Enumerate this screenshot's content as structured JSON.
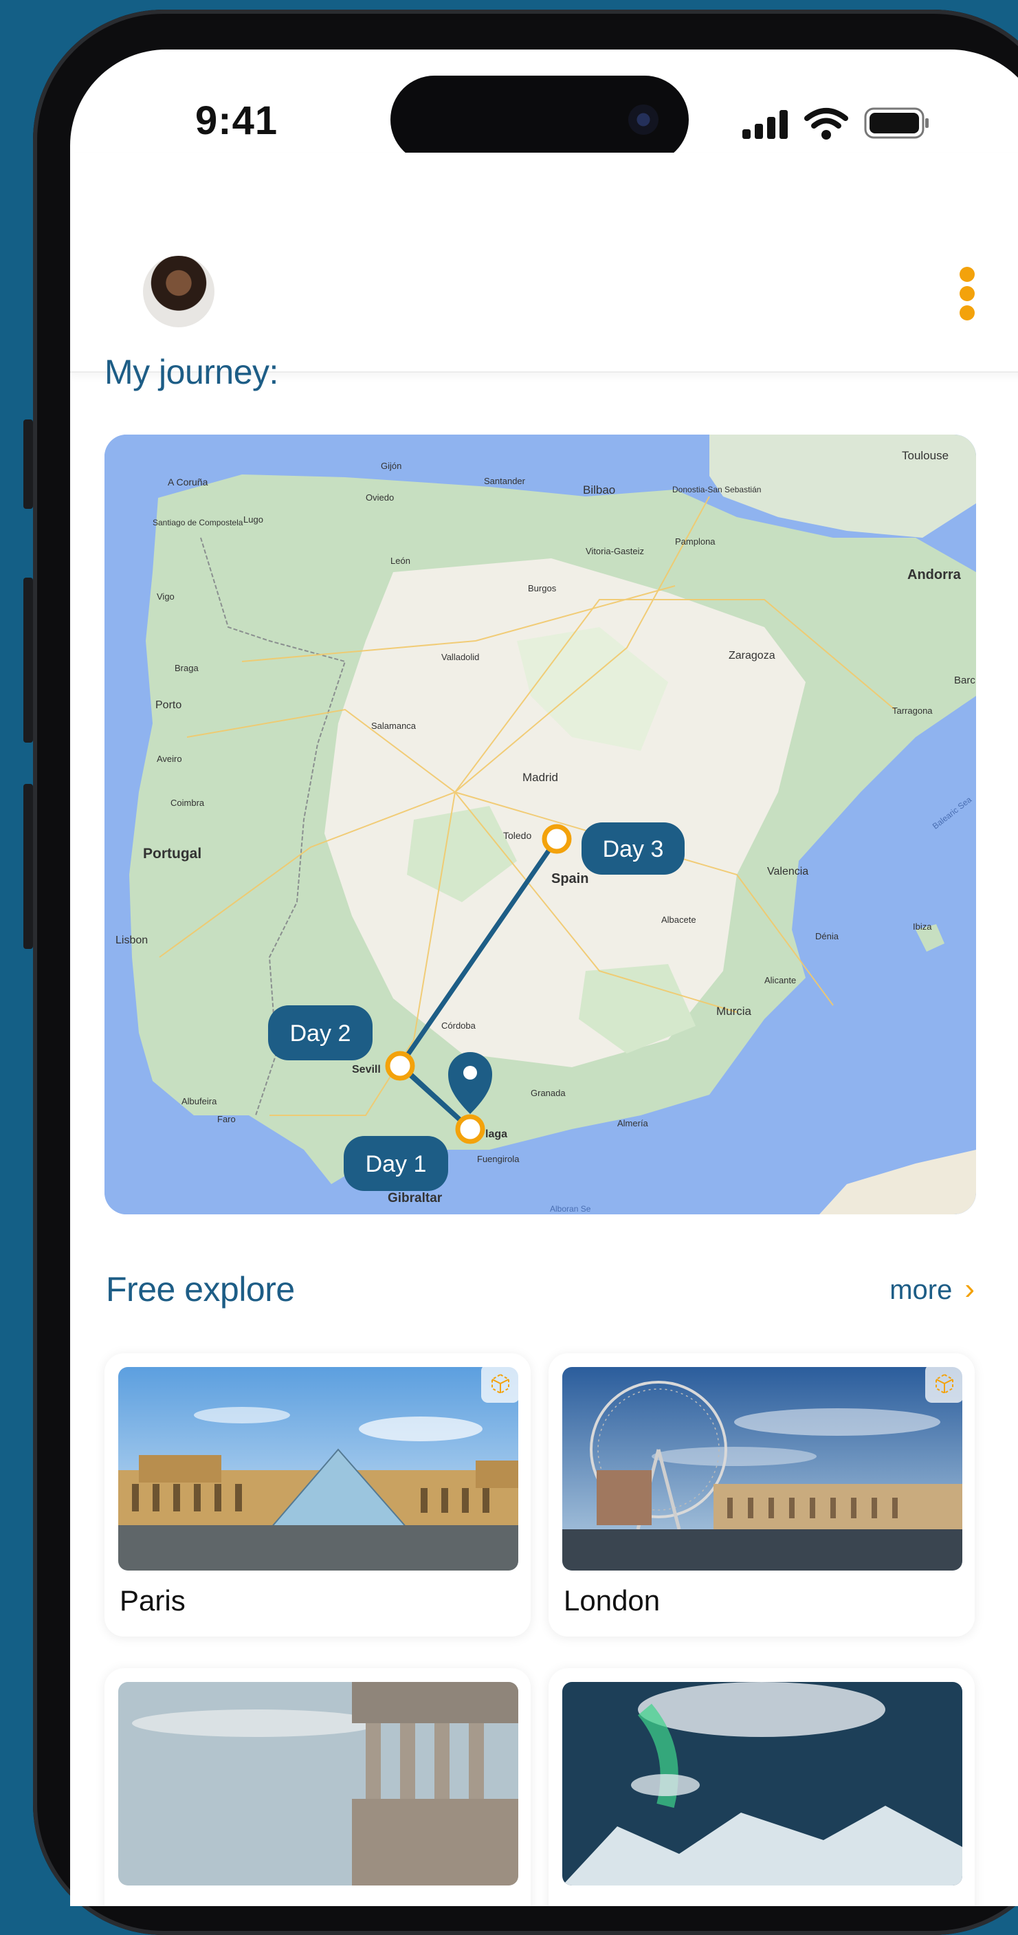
{
  "status_bar": {
    "time": "9:41"
  },
  "colors": {
    "accent_orange": "#f3a20b",
    "primary_blue": "#1d5d86",
    "background": "#145f86"
  },
  "header": {
    "avatar": "avatar",
    "menu_icon": "more-vertical-icon"
  },
  "journey": {
    "title": "My journey:",
    "map": {
      "place_labels": [
        "Toulouse",
        "A Coruña",
        "Gijón",
        "Santander",
        "Bilbao",
        "Donostia-San Sebastián",
        "Oviedo",
        "Lugo",
        "Santiago de Compostela",
        "Vitoria-Gasteiz",
        "Pamplona",
        "León",
        "Andorra",
        "Burgos",
        "Vigo",
        "Zaragoza",
        "Valladolid",
        "Braga",
        "Barc",
        "Porto",
        "Tarragona",
        "Salamanca",
        "Aveiro",
        "Madrid",
        "Coimbra",
        "Balearic Sea",
        "Toledo",
        "Portugal",
        "Spain",
        "Valencia",
        "Albacete",
        "Lisbon",
        "Ibiza",
        "Dénia",
        "Alicante",
        "Córdoba",
        "Murcia",
        "Sevill",
        "Granada",
        "Albufeira",
        "Faro",
        "laga",
        "Almería",
        "Fuengirola",
        "Gibraltar",
        "Alboran Se"
      ],
      "stops": [
        "Day 1",
        "Day 2",
        "Day 3"
      ]
    }
  },
  "explore": {
    "title": "Free explore",
    "more_label": "more",
    "cards": [
      {
        "name": "Paris",
        "badge_icon": "ar-cube-icon"
      },
      {
        "name": "London",
        "badge_icon": "ar-cube-icon"
      },
      {
        "name": "",
        "badge_icon": ""
      },
      {
        "name": "",
        "badge_icon": ""
      }
    ]
  }
}
